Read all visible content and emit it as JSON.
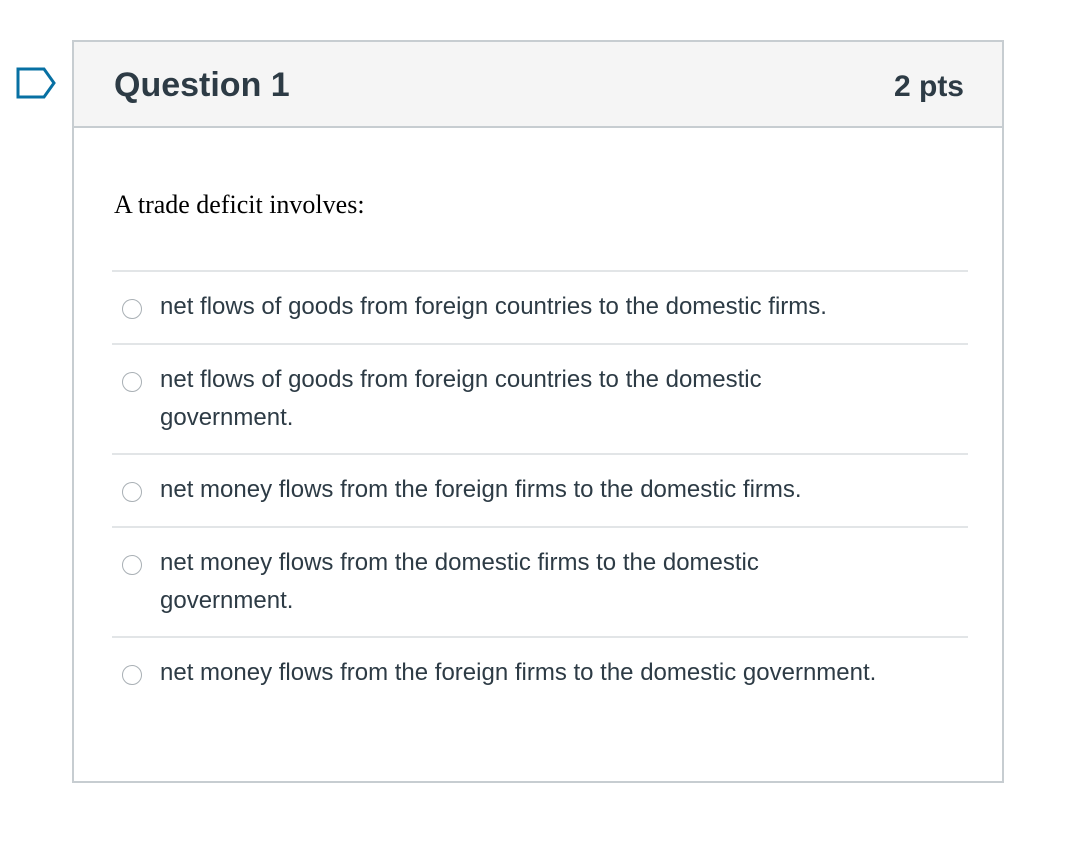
{
  "question": {
    "title": "Question 1",
    "points": "2 pts",
    "text": "A trade deficit involves:",
    "flag_icon": "flag-outline-icon",
    "accent_color": "#0770a3"
  },
  "answers": [
    {
      "label": "net flows of goods from foreign countries to the domestic firms.",
      "selected": false
    },
    {
      "label": "net flows of goods from foreign countries to the domestic government.",
      "selected": false
    },
    {
      "label": "net money flows from the foreign firms to the domestic firms.",
      "selected": false
    },
    {
      "label": "net money flows from the domestic firms to the domestic government.",
      "selected": false
    },
    {
      "label": "net money flows from the foreign firms to the domestic government.",
      "selected": false
    }
  ]
}
